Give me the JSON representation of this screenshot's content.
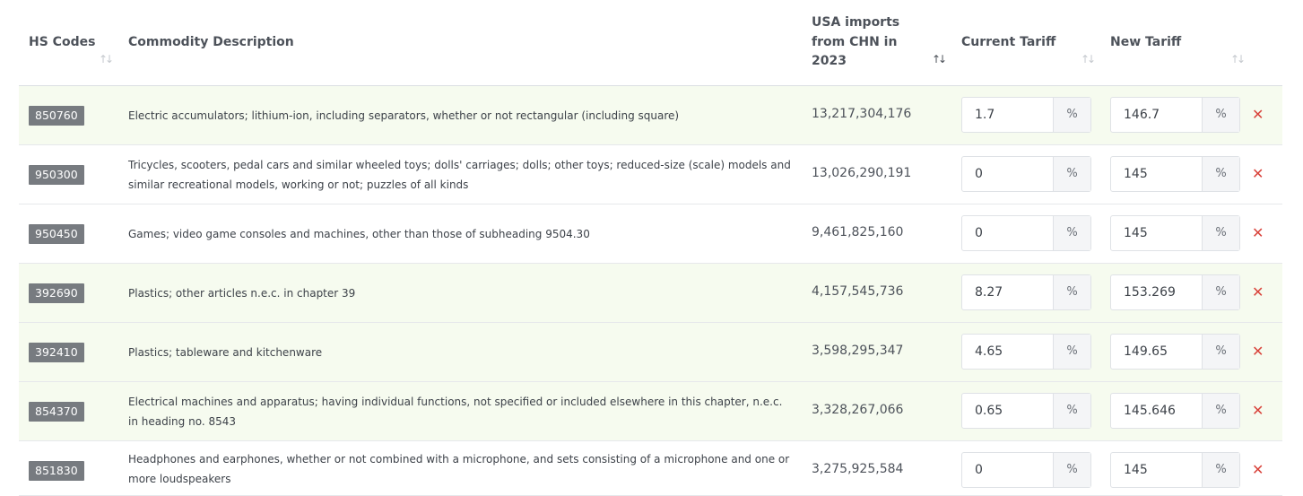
{
  "headers": {
    "hs_codes": "HS Codes",
    "description": "Commodity Description",
    "imports": [
      "USA imports",
      "from CHN in",
      "2023"
    ],
    "current_tariff": "Current Tariff",
    "new_tariff": "New Tariff",
    "sort_glyph": "↑↓"
  },
  "percent_unit": "%",
  "remove_glyph": "✕",
  "rows": [
    {
      "code": "850760",
      "description": "Electric accumulators; lithium-ion, including separators, whether or not rectangular (including square)",
      "imports": "13,217,304,176",
      "current_tariff": "1.7",
      "new_tariff": "146.7",
      "highlighted": true
    },
    {
      "code": "950300",
      "description": "Tricycles, scooters, pedal cars and similar wheeled toys; dolls' carriages; dolls; other toys; reduced-size (scale) models and similar recreational models, working or not; puzzles of all kinds",
      "imports": "13,026,290,191",
      "current_tariff": "0",
      "new_tariff": "145",
      "highlighted": false
    },
    {
      "code": "950450",
      "description": "Games; video game consoles and machines, other than those of subheading 9504.30",
      "imports": "9,461,825,160",
      "current_tariff": "0",
      "new_tariff": "145",
      "highlighted": false
    },
    {
      "code": "392690",
      "description": "Plastics; other articles n.e.c. in chapter 39",
      "imports": "4,157,545,736",
      "current_tariff": "8.27",
      "new_tariff": "153.269",
      "highlighted": true
    },
    {
      "code": "392410",
      "description": "Plastics; tableware and kitchenware",
      "imports": "3,598,295,347",
      "current_tariff": "4.65",
      "new_tariff": "149.65",
      "highlighted": true
    },
    {
      "code": "854370",
      "description": "Electrical machines and apparatus; having individual functions, not specified or included elsewhere in this chapter, n.e.c. in heading no. 8543",
      "imports": "3,328,267,066",
      "current_tariff": "0.65",
      "new_tariff": "145.646",
      "highlighted": true
    },
    {
      "code": "851830",
      "description": "Headphones and earphones, whether or not combined with a microphone, and sets consisting of a microphone and one or more loudspeakers",
      "imports": "3,275,925,584",
      "current_tariff": "0",
      "new_tariff": "145",
      "highlighted": false
    }
  ]
}
